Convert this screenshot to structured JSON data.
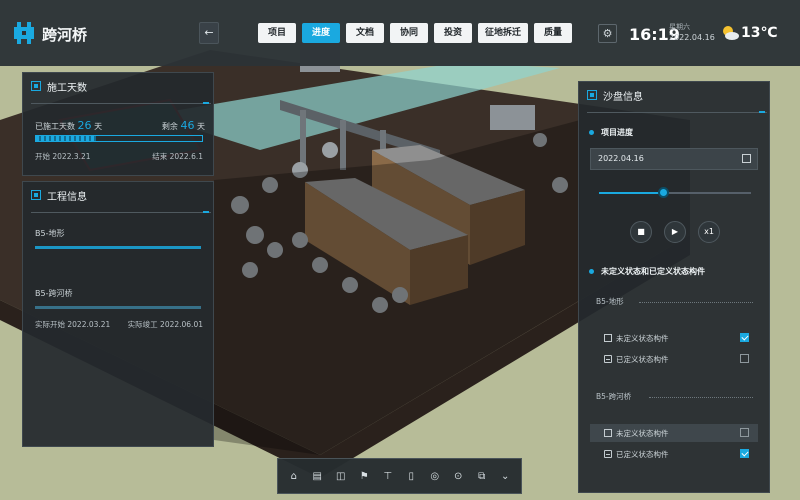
{
  "app": {
    "title": "跨河桥"
  },
  "header": {
    "nav": [
      {
        "label": "项目",
        "active": false
      },
      {
        "label": "进度",
        "active": true
      },
      {
        "label": "文档",
        "active": false
      },
      {
        "label": "协同",
        "active": false
      },
      {
        "label": "投资",
        "active": false
      },
      {
        "label": "征地拆迁",
        "active": false
      },
      {
        "label": "质量",
        "active": false
      }
    ],
    "time": "16:19",
    "weekday": "星期六",
    "date": "2022.04.16",
    "temperature": "13℃",
    "weather_icon": "sun-cloud-icon"
  },
  "construction_days": {
    "title": "施工天数",
    "elapsed_label": "已施工天数",
    "elapsed": "26",
    "remaining_label": "剩余",
    "remaining": "46",
    "unit": "天",
    "progress": 0.36,
    "start_label": "开始",
    "start": "2022.3.21",
    "end_label": "结束",
    "end": "2022.6.1"
  },
  "project_info": {
    "title": "工程信息",
    "items": [
      {
        "label": "B5-地形"
      },
      {
        "label": "B5-跨河桥"
      }
    ],
    "actual_start_label": "实际开始",
    "actual_start": "2022.03.21",
    "actual_end_label": "实际竣工",
    "actual_end": "2022.06.01"
  },
  "sandbox": {
    "title": "沙盘信息",
    "progress_section": "项目进度",
    "date": "2022.04.16",
    "slider_value": 0.42,
    "speed": "x1",
    "state_section": "未定义状态和已定义状态构件",
    "groups": [
      {
        "label": "B5-地形",
        "rows": [
          {
            "label": "未定义状态构件",
            "checked": true,
            "highlight": false
          },
          {
            "label": "已定义状态构件",
            "checked": false,
            "highlight": false
          }
        ]
      },
      {
        "label": "B5-跨河桥",
        "rows": [
          {
            "label": "未定义状态构件",
            "checked": false,
            "highlight": true
          },
          {
            "label": "已定义状态构件",
            "checked": true,
            "highlight": false
          }
        ]
      }
    ]
  },
  "toolbar": {
    "tools": [
      "home-icon",
      "layers-icon",
      "split-icon",
      "flag-icon",
      "tree-icon",
      "page-icon",
      "globe-icon",
      "pin-icon",
      "copy-icon",
      "more-down-icon"
    ]
  },
  "colors": {
    "accent": "#1aa9e0",
    "panel": "#23292d",
    "ground": "#b9be9a"
  }
}
